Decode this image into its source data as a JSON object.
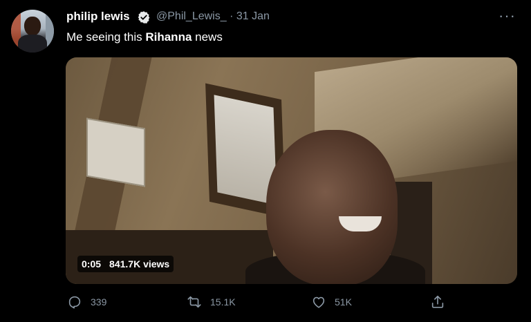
{
  "author": {
    "display_name": "philip lewis",
    "handle": "@Phil_Lewis_",
    "separator": "·",
    "date": "31 Jan",
    "verified": true
  },
  "tweet": {
    "text_before": "Me seeing this ",
    "text_bold": "Rihanna",
    "text_after": " news"
  },
  "video": {
    "duration": "0:05",
    "views": "841.7K views"
  },
  "actions": {
    "replies": "339",
    "retweets": "15.1K",
    "likes": "51K"
  },
  "icons": {
    "more": "more-icon",
    "reply": "reply-icon",
    "retweet": "retweet-icon",
    "like": "heart-icon",
    "share": "share-icon",
    "verified": "verified-badge-icon"
  },
  "colors": {
    "background": "#000000",
    "primary_text": "#ffffff",
    "secondary_text": "#8b98a5"
  }
}
